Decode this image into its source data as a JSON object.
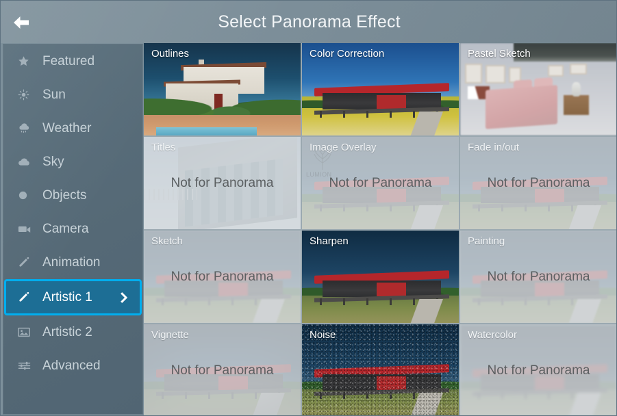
{
  "header": {
    "title": "Select Panorama Effect",
    "back_icon": "arrow-left-icon"
  },
  "sidebar": {
    "items": [
      {
        "label": "Featured",
        "icon": "star-icon",
        "selected": false
      },
      {
        "label": "Sun",
        "icon": "sun-icon",
        "selected": false
      },
      {
        "label": "Weather",
        "icon": "cloud-rain-icon",
        "selected": false
      },
      {
        "label": "Sky",
        "icon": "cloud-icon",
        "selected": false
      },
      {
        "label": "Objects",
        "icon": "circle-icon",
        "selected": false
      },
      {
        "label": "Camera",
        "icon": "camera-icon",
        "selected": false
      },
      {
        "label": "Animation",
        "icon": "pencil-icon",
        "selected": false
      },
      {
        "label": "Artistic 1",
        "icon": "pencil-icon",
        "selected": true,
        "chevron": "chevron-right-icon"
      },
      {
        "label": "Artistic 2",
        "icon": "picture-icon",
        "selected": false
      },
      {
        "label": "Advanced",
        "icon": "sliders-icon",
        "selected": false
      }
    ]
  },
  "grid": {
    "disabled_text": "Not for Panorama",
    "watermark_text": "LUMION",
    "tiles": [
      {
        "label": "Outlines",
        "enabled": true,
        "thumb": "villa"
      },
      {
        "label": "Color Correction",
        "enabled": true,
        "thumb": "redhouse-bright"
      },
      {
        "label": "Pastel Sketch",
        "enabled": true,
        "thumb": "bedroom"
      },
      {
        "label": "Titles",
        "enabled": false,
        "thumb": "building"
      },
      {
        "label": "Image Overlay",
        "enabled": false,
        "thumb": "redhouse-dim",
        "watermark": true
      },
      {
        "label": "Fade in/out",
        "enabled": false,
        "thumb": "redhouse-dim"
      },
      {
        "label": "Sketch",
        "enabled": false,
        "thumb": "redhouse-dim"
      },
      {
        "label": "Sharpen",
        "enabled": true,
        "thumb": "redhouse-dark"
      },
      {
        "label": "Painting",
        "enabled": false,
        "thumb": "redhouse-dim"
      },
      {
        "label": "Vignette",
        "enabled": false,
        "thumb": "redhouse-dim"
      },
      {
        "label": "Noise",
        "enabled": true,
        "thumb": "redhouse-noise"
      },
      {
        "label": "Watercolor",
        "enabled": false,
        "thumb": "redhouse-dim"
      }
    ]
  },
  "colors": {
    "header_bg": "#7d909b",
    "sidebar_bg": "#566a77",
    "selected_bg": "#1d6e95",
    "selected_border": "#00aeef",
    "tile_gap": "#9aa8b0",
    "disabled_veil": "#d6dbde"
  }
}
